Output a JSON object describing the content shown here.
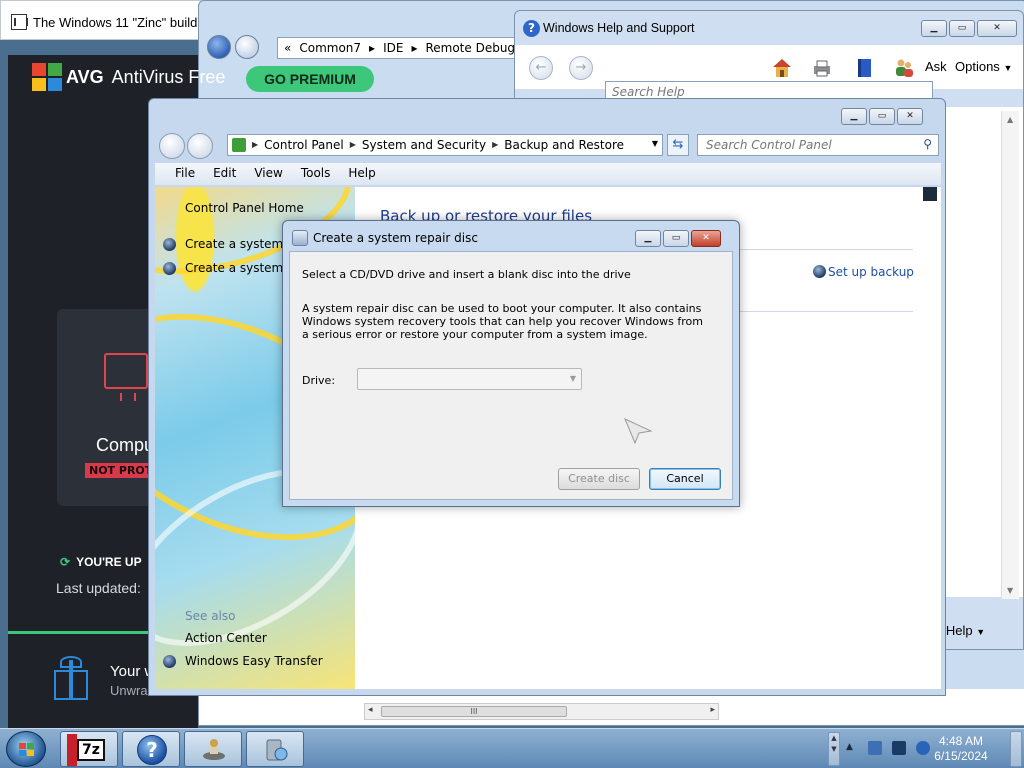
{
  "browser_tab": {
    "title": "The Windows 11 \"Zinc\" build a"
  },
  "explorer_back": {
    "breadcrumb": [
      "«",
      "Common7",
      "IDE",
      "Remote Debug"
    ],
    "hscroll_grip": "III"
  },
  "help_window": {
    "title": "Windows Help and Support",
    "ask_label": "Ask",
    "options_label": "Options",
    "search_placeholder": "Search Help",
    "bottom_label": "e Help"
  },
  "avg": {
    "brand_bold": "AVG",
    "brand_name": "AntiVirus Free",
    "premium_button": "GO PREMIUM",
    "computer_label": "Compu",
    "status_badge": "NOT PROTE",
    "status_line": "YOU'RE UP",
    "last_updated": "Last updated:",
    "promo_title": "Your w",
    "promo_sub": "Unwra"
  },
  "control_panel": {
    "breadcrumb": [
      "Control Panel",
      "System and Security",
      "Backup and Restore"
    ],
    "search_placeholder": "Search Control Panel",
    "menu": [
      "File",
      "Edit",
      "View",
      "Tools",
      "Help"
    ],
    "left_pane": {
      "home": "Control Panel Home",
      "task_1": "Create a system im",
      "task_2": "Create a system rep",
      "see_also": "See also",
      "link_action_center": "Action Center",
      "link_easy_transfer": "Windows Easy Transfer"
    },
    "heading": "Back up or restore your files",
    "setup_link": "Set up backup"
  },
  "dialog": {
    "title": "Create a system repair disc",
    "instruction": "Select a CD/DVD drive and insert a blank disc into the drive",
    "description": "A system repair disc can be used to boot your computer. It also contains Windows system recovery tools that can help you recover Windows from a serious error or restore your computer from a system image.",
    "drive_label": "Drive:",
    "drive_value": "",
    "create_button": "Create disc",
    "cancel_button": "Cancel"
  },
  "taskbar": {
    "sevenzip_label": "7z",
    "help_glyph": "?",
    "time": "4:48 AM",
    "date": "6/15/2024"
  },
  "colors": {
    "avg_green": "#3cc77a",
    "link_blue": "#1e4fa3",
    "close_red": "#c2402a"
  },
  "icons": [
    "house-icon",
    "printer-icon",
    "book-icon",
    "people-icon",
    "search-icon",
    "refresh-icon",
    "windows-start-icon",
    "sevenzip-icon",
    "help-icon",
    "network-icon",
    "volume-icon"
  ]
}
